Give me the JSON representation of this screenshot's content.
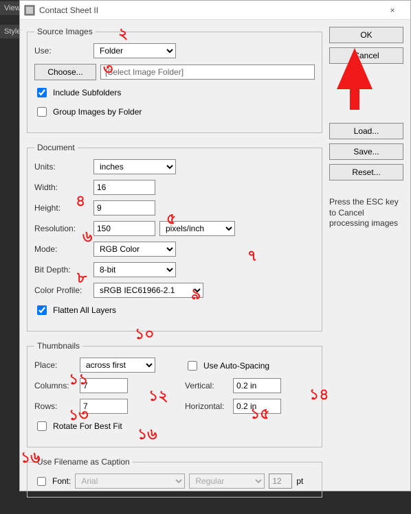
{
  "sidebar": {
    "tab1": "View",
    "tab2": "Styles"
  },
  "titlebar": {
    "title": "Contact Sheet II",
    "close": "×"
  },
  "source": {
    "legend": "Source Images",
    "use_label": "Use:",
    "use_value": "Folder",
    "choose_label": "Choose...",
    "folder_display": "[Select Image Folder]",
    "include_subfolders_label": "Include Subfolders",
    "include_subfolders_checked": true,
    "group_by_folder_label": "Group Images by Folder",
    "group_by_folder_checked": false
  },
  "document": {
    "legend": "Document",
    "units_label": "Units:",
    "units_value": "inches",
    "width_label": "Width:",
    "width_value": "16",
    "height_label": "Height:",
    "height_value": "9",
    "resolution_label": "Resolution:",
    "resolution_value": "150",
    "resolution_units": "pixels/inch",
    "mode_label": "Mode:",
    "mode_value": "RGB Color",
    "bitdepth_label": "Bit Depth:",
    "bitdepth_value": "8-bit",
    "profile_label": "Color Profile:",
    "profile_value": "sRGB IEC61966-2.1",
    "flatten_label": "Flatten All Layers",
    "flatten_checked": true
  },
  "thumbnails": {
    "legend": "Thumbnails",
    "place_label": "Place:",
    "place_value": "across first",
    "autospacing_label": "Use Auto-Spacing",
    "autospacing_checked": false,
    "columns_label": "Columns:",
    "columns_value": "7",
    "vertical_label": "Vertical:",
    "vertical_value": "0.2 in",
    "rows_label": "Rows:",
    "rows_value": "7",
    "horizontal_label": "Horizontal:",
    "horizontal_value": "0.2 in",
    "rotate_label": "Rotate For Best Fit",
    "rotate_checked": false
  },
  "caption": {
    "legend": "Use Filename as Caption",
    "enabled_checked": false,
    "font_label": "Font:",
    "font_value": "Arial",
    "style_value": "Regular",
    "size_value": "12",
    "size_unit": "pt"
  },
  "buttons": {
    "ok": "OK",
    "cancel": "Cancel",
    "load": "Load...",
    "save": "Save...",
    "reset": "Reset..."
  },
  "hint": "Press the ESC key to Cancel processing images",
  "annotations": {
    "n2": "২",
    "n3": "৩",
    "n4": "৪",
    "n5": "৫",
    "n6": "৬",
    "n7": "৭",
    "n8": "৮",
    "n9": "৯",
    "n10": "১০",
    "n11": "১১",
    "n12": "১২",
    "n13": "১৩",
    "n14": "১৪",
    "n15": "১৫",
    "n16": "১৬"
  }
}
